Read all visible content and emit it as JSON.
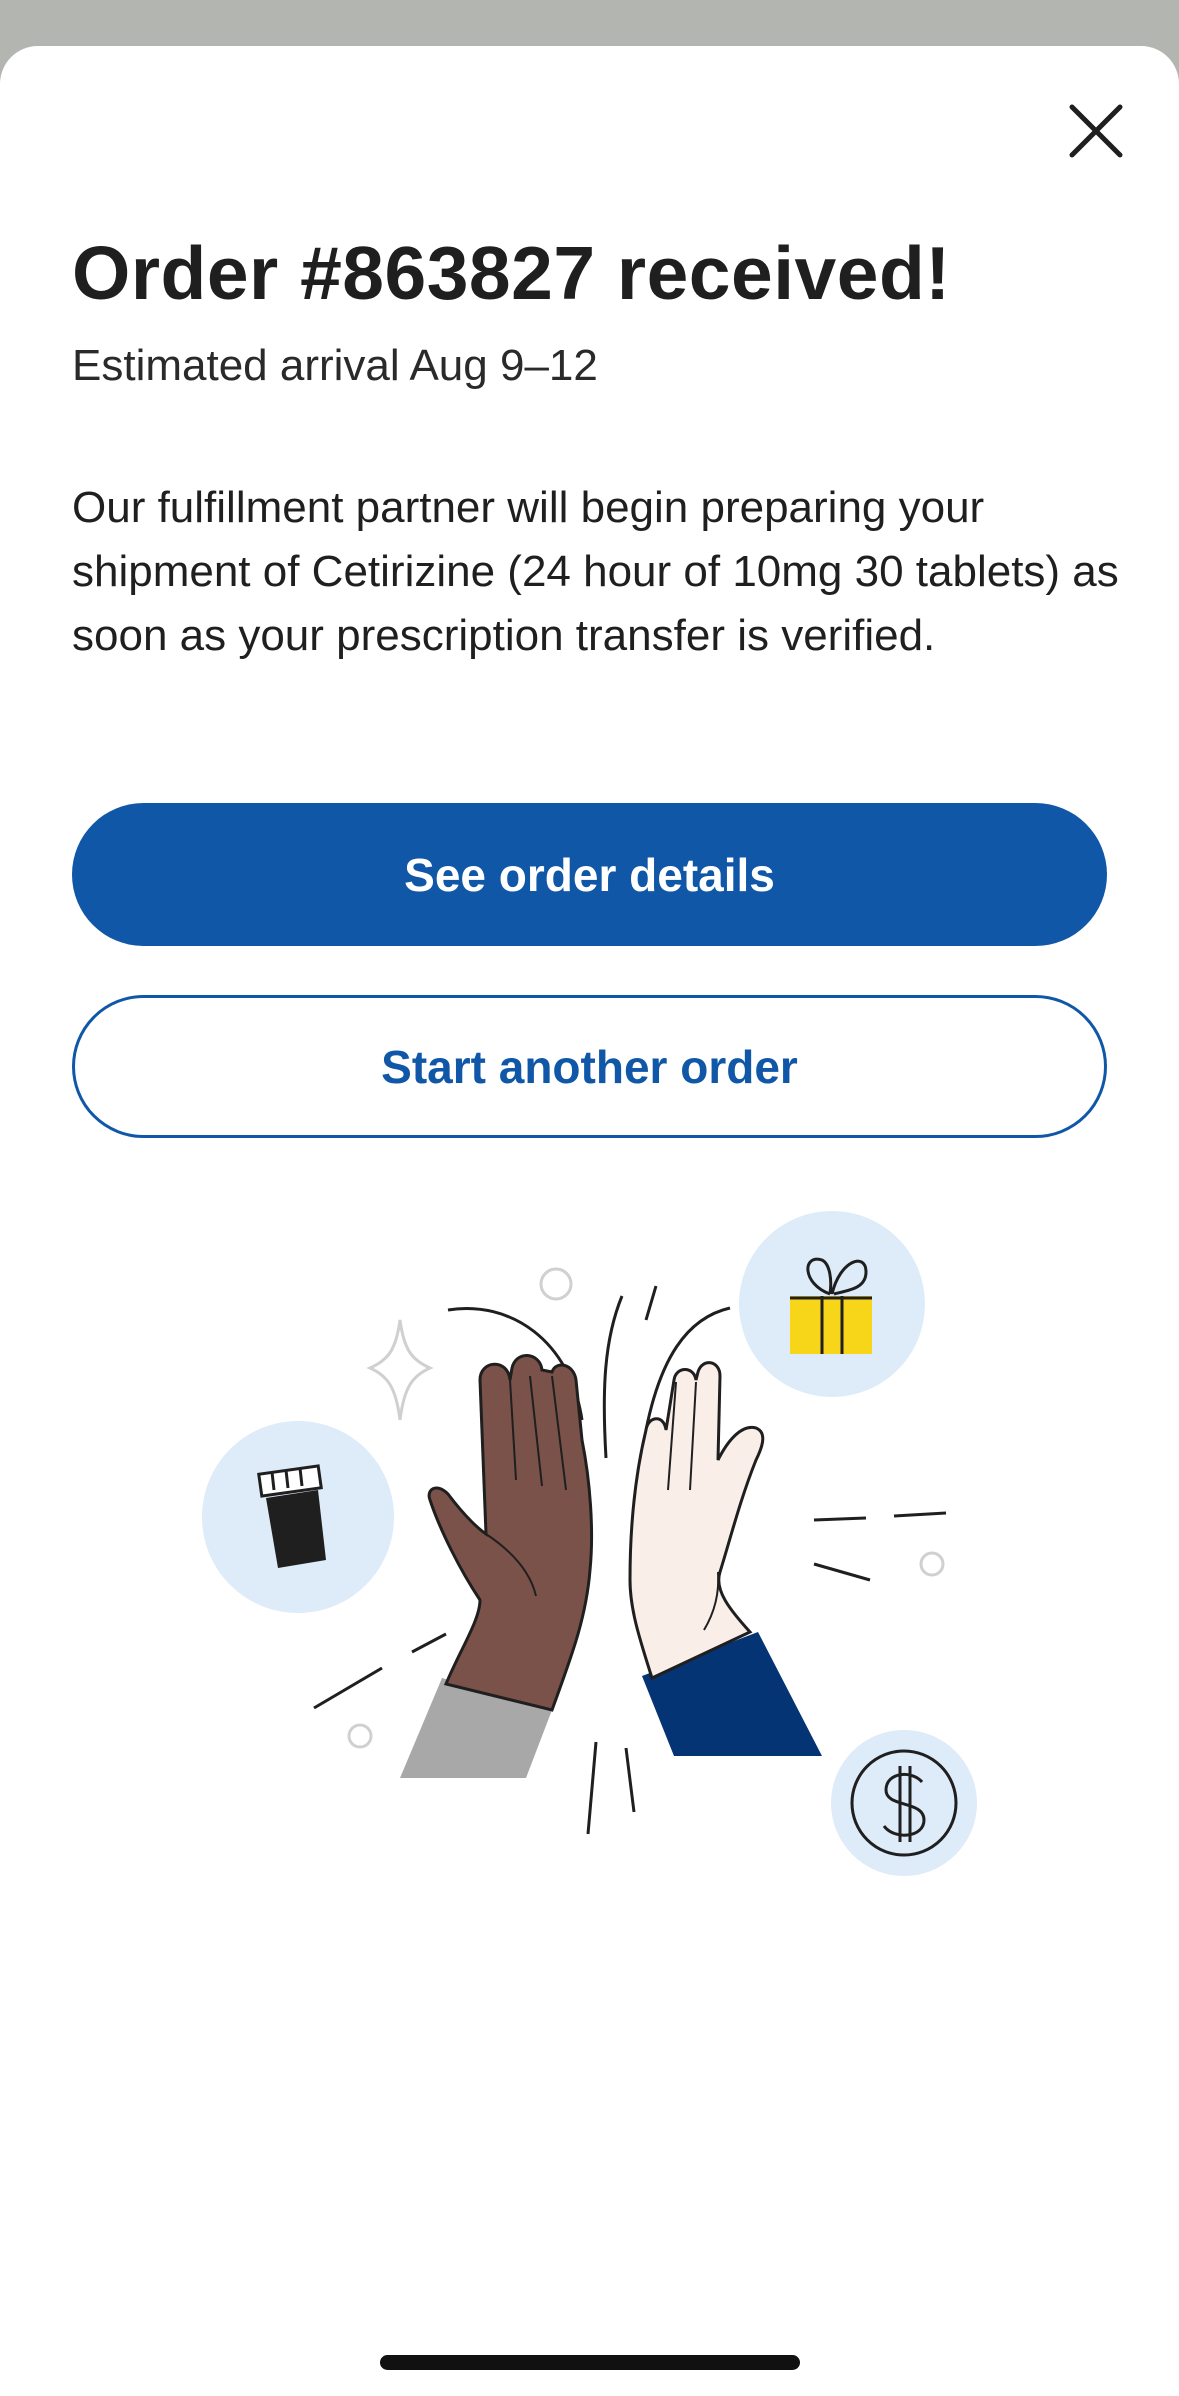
{
  "dialog": {
    "close_icon": "close-icon",
    "title": "Order #863827 received!",
    "subtitle": "Estimated arrival Aug 9–12",
    "message": "Our fulfillment partner will begin preparing your shipment of Cetirizine (24 hour of 10mg 30 tablets) as soon as your prescription transfer is verified.",
    "primary_button": "See order details",
    "secondary_button": "Start another order"
  },
  "illustration": {
    "name": "high-five-illustration",
    "icons": [
      "pill-bottle-icon",
      "gift-icon",
      "dollar-coin-icon"
    ]
  },
  "colors": {
    "primary": "#1057a7",
    "backdrop": "#b3b5b1",
    "bubble": "#deebf8",
    "gift_yellow": "#f7d619",
    "sleeve_navy": "#043474",
    "sleeve_gray": "#a8a8a8",
    "hand_dark": "#7a5249",
    "hand_light": "#faeee8"
  }
}
